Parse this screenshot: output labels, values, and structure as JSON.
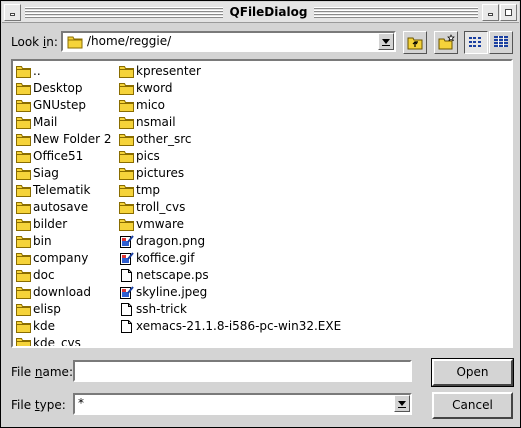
{
  "window": {
    "title": "QFileDialog"
  },
  "lookin": {
    "label_pre": "Look ",
    "label_key": "i",
    "label_post": "n:",
    "path": "/home/reggie/"
  },
  "toolbar": {
    "up_icon": "folder-up-icon",
    "newfolder_icon": "new-folder-icon",
    "detail_icon": "detail-view-icon",
    "list_icon": "list-view-icon"
  },
  "files": {
    "column1": [
      {
        "name": "..",
        "icon": "folder"
      },
      {
        "name": "Desktop",
        "icon": "folder"
      },
      {
        "name": "GNUstep",
        "icon": "folder"
      },
      {
        "name": "Mail",
        "icon": "folder"
      },
      {
        "name": "New Folder 2",
        "icon": "folder"
      },
      {
        "name": "Office51",
        "icon": "folder"
      },
      {
        "name": "Siag",
        "icon": "folder"
      },
      {
        "name": "Telematik",
        "icon": "folder"
      },
      {
        "name": "autosave",
        "icon": "folder"
      },
      {
        "name": "bilder",
        "icon": "folder"
      },
      {
        "name": "bin",
        "icon": "folder"
      },
      {
        "name": "company",
        "icon": "folder"
      },
      {
        "name": "doc",
        "icon": "folder"
      },
      {
        "name": "download",
        "icon": "folder"
      },
      {
        "name": "elisp",
        "icon": "folder"
      },
      {
        "name": "kde",
        "icon": "folder"
      },
      {
        "name": "kde_cvs",
        "icon": "folder"
      }
    ],
    "column2": [
      {
        "name": "kpresenter",
        "icon": "folder"
      },
      {
        "name": "kword",
        "icon": "folder"
      },
      {
        "name": "mico",
        "icon": "folder"
      },
      {
        "name": "nsmail",
        "icon": "folder"
      },
      {
        "name": "other_src",
        "icon": "folder"
      },
      {
        "name": "pics",
        "icon": "folder"
      },
      {
        "name": "pictures",
        "icon": "folder"
      },
      {
        "name": "tmp",
        "icon": "folder"
      },
      {
        "name": "troll_cvs",
        "icon": "folder"
      },
      {
        "name": "vmware",
        "icon": "folder"
      },
      {
        "name": "dragon.png",
        "icon": "image"
      },
      {
        "name": "koffice.gif",
        "icon": "image"
      },
      {
        "name": "netscape.ps",
        "icon": "file"
      },
      {
        "name": "skyline.jpeg",
        "icon": "image"
      },
      {
        "name": "ssh-trick",
        "icon": "file"
      },
      {
        "name": "xemacs-21.1.8-i586-pc-win32.EXE",
        "icon": "file"
      }
    ]
  },
  "filename": {
    "label_pre": "File ",
    "label_key": "n",
    "label_post": "ame:",
    "value": ""
  },
  "filetype": {
    "label_pre": "File ",
    "label_key": "t",
    "label_post": "ype:",
    "value": "*"
  },
  "buttons": {
    "open": "Open",
    "cancel": "Cancel"
  },
  "colors": {
    "folder": "#f5d33a",
    "folder_edge": "#8a6d00",
    "image_accent": "#2f5fd0"
  }
}
